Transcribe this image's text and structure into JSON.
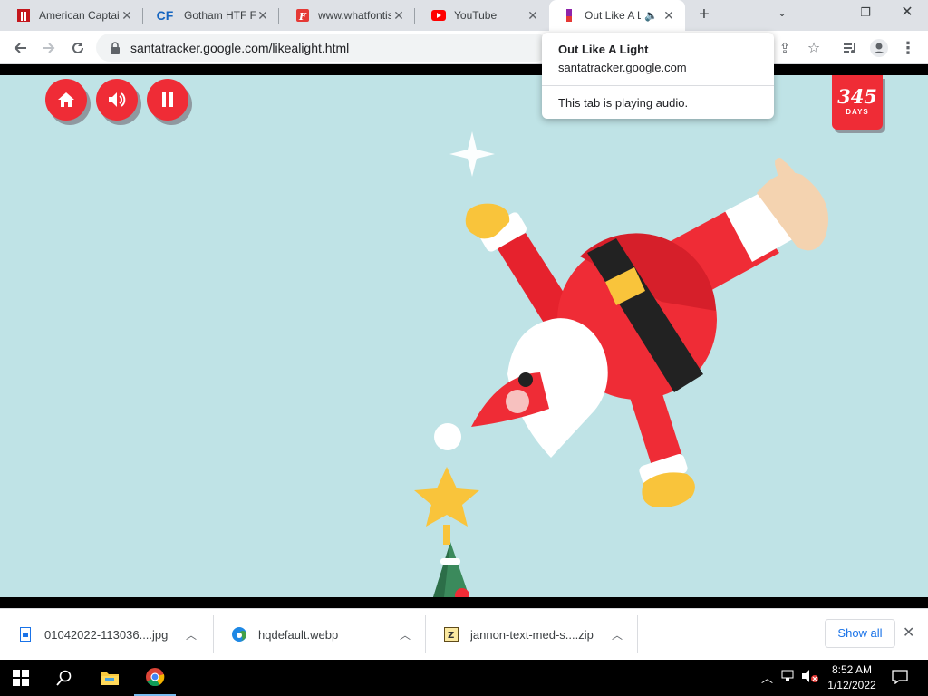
{
  "browser": {
    "tabs": [
      {
        "title": "American Captain",
        "favicon": "red-document-icon",
        "active": false
      },
      {
        "title": "Gotham HTF Font",
        "favicon": "cf-icon",
        "favicon_text": "CF",
        "active": false
      },
      {
        "title": "www.whatfontis.com",
        "favicon": "whatfontis-icon",
        "active": false
      },
      {
        "title": "YouTube",
        "favicon": "youtube-icon",
        "active": false
      },
      {
        "title": "Out Like A Light",
        "favicon": "santa-tracker-icon",
        "active": true,
        "playing_audio": true
      }
    ],
    "url": "santatracker.google.com/likealight.html"
  },
  "popup": {
    "title": "Out Like A Light",
    "subtitle": "santatracker.google.com",
    "audio_message": "This tab is playing audio."
  },
  "game": {
    "days_count": "345",
    "days_label": "DAYS",
    "buttons": [
      "home-icon",
      "speaker-icon",
      "pause-icon"
    ]
  },
  "downloads": {
    "items": [
      {
        "name": "01042022-113036....jpg",
        "icon": "image-file-icon"
      },
      {
        "name": "hqdefault.webp",
        "icon": "edge-icon"
      },
      {
        "name": "jannon-text-med-s....zip",
        "icon": "zip-file-icon"
      }
    ],
    "show_all": "Show all"
  },
  "taskbar": {
    "time": "8:52 AM",
    "date": "1/12/2022"
  },
  "colors": {
    "sky": "#bfe3e6",
    "accent_red": "#ef2c36",
    "link_blue": "#1a73e8"
  }
}
